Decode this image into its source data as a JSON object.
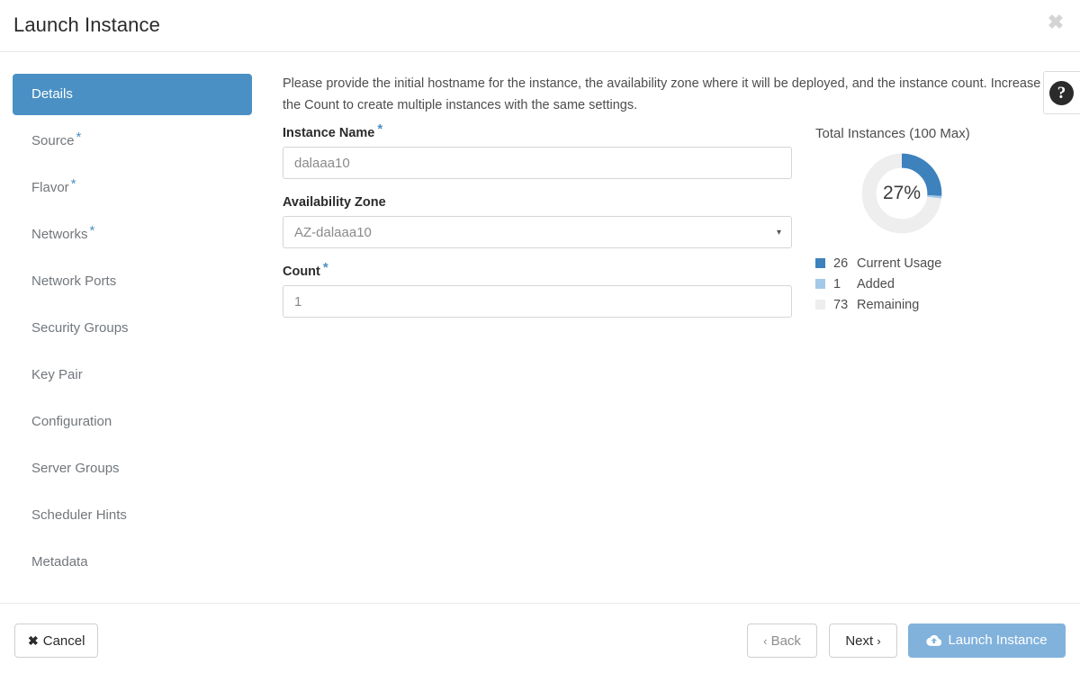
{
  "header": {
    "title": "Launch Instance",
    "close_icon": "close-icon",
    "close_label": "✖"
  },
  "sidebar": {
    "items": [
      {
        "label": "Details",
        "required": false,
        "active": true
      },
      {
        "label": "Source",
        "required": true,
        "active": false
      },
      {
        "label": "Flavor",
        "required": true,
        "active": false
      },
      {
        "label": "Networks",
        "required": true,
        "active": false
      },
      {
        "label": "Network Ports",
        "required": false,
        "active": false
      },
      {
        "label": "Security Groups",
        "required": false,
        "active": false
      },
      {
        "label": "Key Pair",
        "required": false,
        "active": false
      },
      {
        "label": "Configuration",
        "required": false,
        "active": false
      },
      {
        "label": "Server Groups",
        "required": false,
        "active": false
      },
      {
        "label": "Scheduler Hints",
        "required": false,
        "active": false
      },
      {
        "label": "Metadata",
        "required": false,
        "active": false
      }
    ],
    "required_marker": "*"
  },
  "main": {
    "description": "Please provide the initial hostname for the instance, the availability zone where it will be deployed, and the instance count. Increase the Count to create multiple instances with the same settings.",
    "help_icon": "help-circle-icon",
    "help_glyph": "?",
    "fields": {
      "instance_name": {
        "label": "Instance Name",
        "required_marker": "*",
        "value": "dalaaa10",
        "placeholder": ""
      },
      "availability_zone": {
        "label": "Availability Zone",
        "required_marker": "",
        "value": "AZ-dalaaa10",
        "options": [
          "AZ-dalaaa10"
        ],
        "caret_icon": "chevron-down-icon",
        "caret_glyph": "▾"
      },
      "count": {
        "label": "Count",
        "required_marker": "*",
        "value": "1",
        "placeholder": ""
      }
    }
  },
  "chart_data": {
    "type": "pie",
    "title": "Total Instances (100 Max)",
    "center_label": "27%",
    "max": 100,
    "categories": [
      "Current Usage",
      "Added",
      "Remaining"
    ],
    "values": [
      26,
      1,
      73
    ],
    "colors": [
      "#3d82bd",
      "#a3c8e8",
      "#eeeeee"
    ],
    "legend": [
      {
        "value": "26",
        "label": "Current Usage",
        "color": "#3d82bd"
      },
      {
        "value": "1",
        "label": "Added",
        "color": "#a3c8e8"
      },
      {
        "value": "73",
        "label": "Remaining",
        "color": "#eeeeee"
      }
    ],
    "legend_position": "bottom-left",
    "grid": false
  },
  "footer": {
    "cancel": {
      "label": "Cancel",
      "icon": "close-x-icon",
      "glyph": "✖"
    },
    "back": {
      "label": "Back",
      "icon": "chevron-left-icon",
      "glyph": "‹"
    },
    "next": {
      "label": "Next",
      "icon": "chevron-right-icon",
      "glyph": "›"
    },
    "launch": {
      "label": "Launch Instance",
      "icon": "cloud-upload-icon"
    }
  },
  "theme": {
    "accent": "#4a90c4",
    "launch_button": "#81b2dc",
    "required_star": "#4a90c4"
  }
}
